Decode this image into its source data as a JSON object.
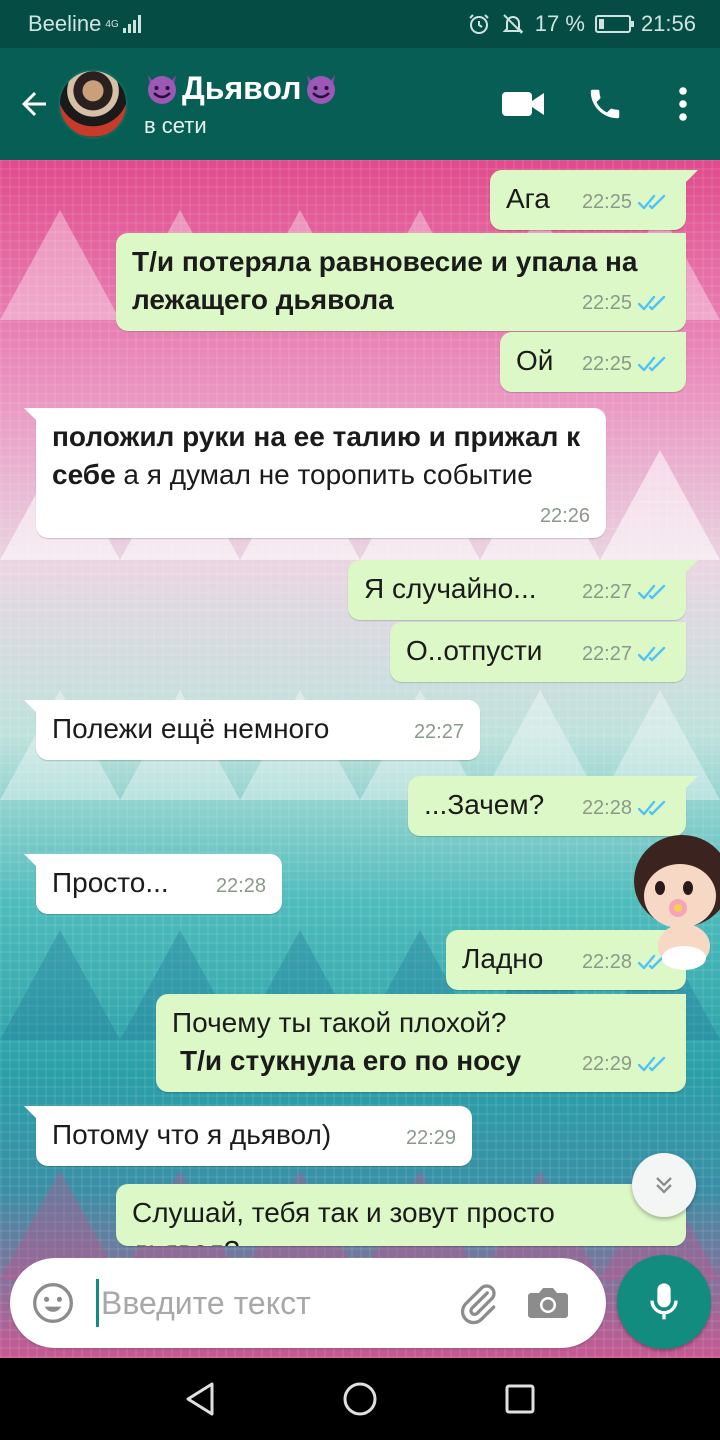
{
  "status_bar": {
    "carrier": "Beeline",
    "network": "4G",
    "battery_text": "17 %",
    "battery_level": 0.17,
    "time": "21:56",
    "icons": [
      "alarm-icon",
      "mute-icon",
      "battery-icon"
    ]
  },
  "header": {
    "contact_name": "Дьявол",
    "name_emoji": "smiling-devil-icon",
    "status": "в сети",
    "actions": [
      "video-call-icon",
      "phone-icon",
      "more-icon"
    ],
    "accent": "#075e54"
  },
  "messages": [
    {
      "dir": "out",
      "html_parts": [
        {
          "t": "Ага"
        }
      ],
      "time": "22:25",
      "read": true
    },
    {
      "dir": "out",
      "html_parts": [
        {
          "t": "Т/и потеряла равновесие и упала на лежащего дьявола",
          "bold": true
        }
      ],
      "time": "22:25",
      "read": true
    },
    {
      "dir": "out",
      "html_parts": [
        {
          "t": "Ой"
        }
      ],
      "time": "22:25",
      "read": true
    },
    {
      "dir": "in",
      "html_parts": [
        {
          "t": "положил руки на ее талию и прижал к себе",
          "bold": true
        },
        {
          "t": " а я думал не торопить событие"
        }
      ],
      "time": "22:26"
    },
    {
      "dir": "out",
      "html_parts": [
        {
          "t": "Я случайно..."
        }
      ],
      "time": "22:27",
      "read": true
    },
    {
      "dir": "out",
      "html_parts": [
        {
          "t": "О..отпусти"
        }
      ],
      "time": "22:27",
      "read": true
    },
    {
      "dir": "in",
      "html_parts": [
        {
          "t": "Полежи  ещё немного"
        }
      ],
      "time": "22:27"
    },
    {
      "dir": "out",
      "html_parts": [
        {
          "t": "...Зачем?"
        }
      ],
      "time": "22:28",
      "read": true
    },
    {
      "dir": "in",
      "html_parts": [
        {
          "t": "Просто..."
        }
      ],
      "time": "22:28"
    },
    {
      "dir": "out",
      "html_parts": [
        {
          "t": "Ладно"
        }
      ],
      "time": "22:28",
      "read": true
    },
    {
      "dir": "out",
      "html_parts": [
        {
          "t": "Почему ты такой плохой?"
        },
        {
          "t": "Т/и стукнула его по носу",
          "bold": true
        }
      ],
      "time": "22:29",
      "read": true
    },
    {
      "dir": "in",
      "html_parts": [
        {
          "t": "Потому что я дьявол)"
        }
      ],
      "time": "22:29"
    },
    {
      "dir": "out",
      "html_parts": [
        {
          "t": "Слушай, тебя так и зовут просто дьявол?"
        }
      ],
      "time": "",
      "read": true
    }
  ],
  "input": {
    "placeholder": "Введите текст",
    "value": ""
  },
  "colors": {
    "outgoing_bubble": "#dcf8c6",
    "incoming_bubble": "#ffffff",
    "read_ticks": "#4fc3f7",
    "mic_button": "#128c7e"
  }
}
